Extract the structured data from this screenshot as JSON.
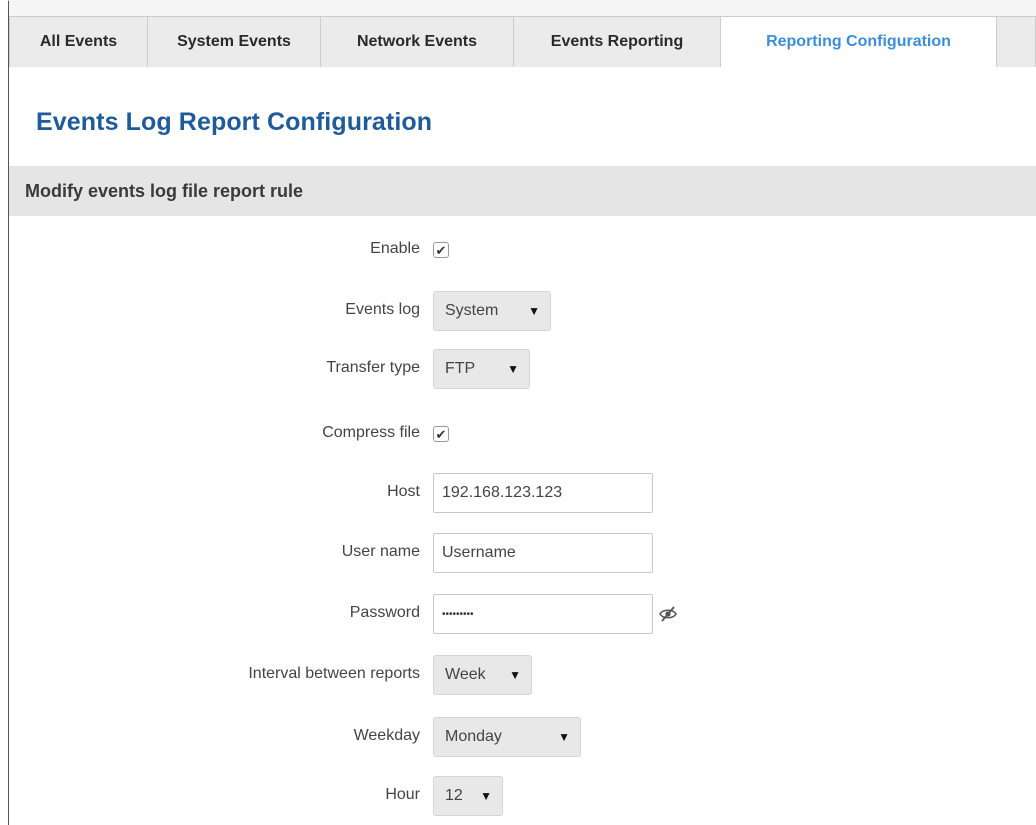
{
  "tabs": [
    {
      "label": "All Events",
      "active": false
    },
    {
      "label": "System Events",
      "active": false
    },
    {
      "label": "Network Events",
      "active": false
    },
    {
      "label": "Events Reporting",
      "active": false
    },
    {
      "label": "Reporting Configuration",
      "active": true
    }
  ],
  "page": {
    "title": "Events Log Report Configuration",
    "section_title": "Modify events log file report rule"
  },
  "form": {
    "enable": {
      "label": "Enable",
      "checked": true
    },
    "events_log": {
      "label": "Events log",
      "value": "System"
    },
    "transfer_type": {
      "label": "Transfer type",
      "value": "FTP"
    },
    "compress_file": {
      "label": "Compress file",
      "checked": true
    },
    "host": {
      "label": "Host",
      "value": "192.168.123.123"
    },
    "user_name": {
      "label": "User name",
      "value": "Username"
    },
    "password": {
      "label": "Password",
      "value": "•••••••••"
    },
    "interval": {
      "label": "Interval between reports",
      "value": "Week"
    },
    "weekday": {
      "label": "Weekday",
      "value": "Monday"
    },
    "hour": {
      "label": "Hour",
      "value": "12"
    }
  },
  "glyphs": {
    "check": "✔",
    "caret": "▼"
  },
  "colors": {
    "accent": "#3d8ed8",
    "title": "#1f5a9a",
    "section_bg": "#e5e5e5"
  }
}
